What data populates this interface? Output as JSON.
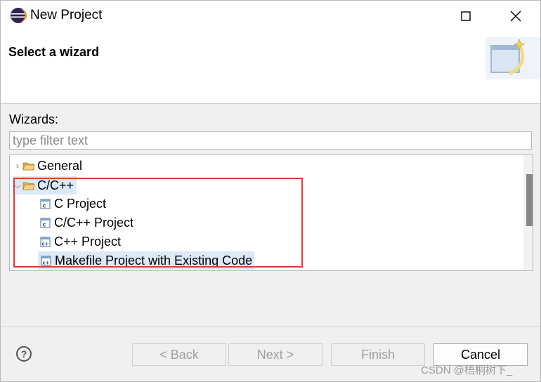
{
  "window": {
    "title": "New Project",
    "app_icon": "eclipse-icon"
  },
  "header": {
    "title": "Select a wizard",
    "banner_icon": "wizard-banner-icon"
  },
  "wizards_label": "Wizards:",
  "filter": {
    "placeholder": "type filter text",
    "value": ""
  },
  "tree": {
    "items": [
      {
        "label": "General",
        "icon": "folder-icon",
        "expanded": false,
        "level": 0
      },
      {
        "label": "C/C++",
        "icon": "folder-open-icon",
        "expanded": true,
        "level": 0,
        "selected": true
      },
      {
        "label": "C Project",
        "icon": "c-project-icon",
        "level": 1
      },
      {
        "label": "C/C++ Project",
        "icon": "c-project-icon",
        "level": 1
      },
      {
        "label": "C++ Project",
        "icon": "cpp-project-icon",
        "level": 1
      },
      {
        "label": "Makefile Project with Existing Code",
        "icon": "cpp-project-icon",
        "level": 1,
        "highlighted": true
      }
    ]
  },
  "buttons": {
    "back": "< Back",
    "next": "Next >",
    "finish": "Finish",
    "cancel": "Cancel",
    "help": "?"
  },
  "watermark": "CSDN @梧桐树下_",
  "colors": {
    "selection": "#dbe9f9",
    "annotation_box": "#e53935",
    "folder": "#e8b04a"
  }
}
